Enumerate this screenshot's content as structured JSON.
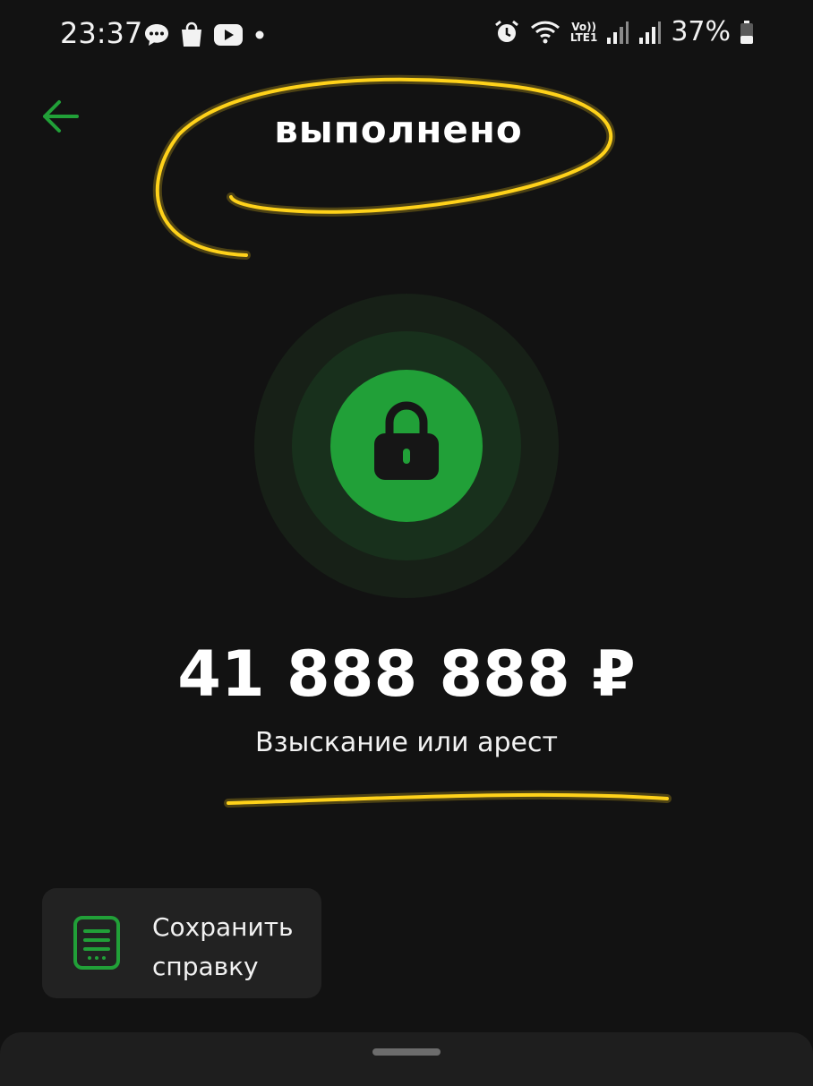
{
  "status_bar": {
    "time": "23:37",
    "left_icons": [
      "messages-icon",
      "shopping-bag-icon",
      "youtube-icon",
      "dot-icon"
    ],
    "lte_top": "Vo))",
    "lte_bottom": "LTE1",
    "battery": "37%"
  },
  "header": {
    "title": "выполнено",
    "back_icon": "arrow-left-icon"
  },
  "status_icon": "lock-icon",
  "transaction": {
    "amount": "41 888 888 ₽",
    "description": "Взыскание или арест"
  },
  "actions": {
    "save_label": "Сохранить справку",
    "save_icon": "document-icon"
  },
  "colors": {
    "background": "#121212",
    "accent_green": "#21a038",
    "highlight_yellow": "#ffd21a"
  }
}
